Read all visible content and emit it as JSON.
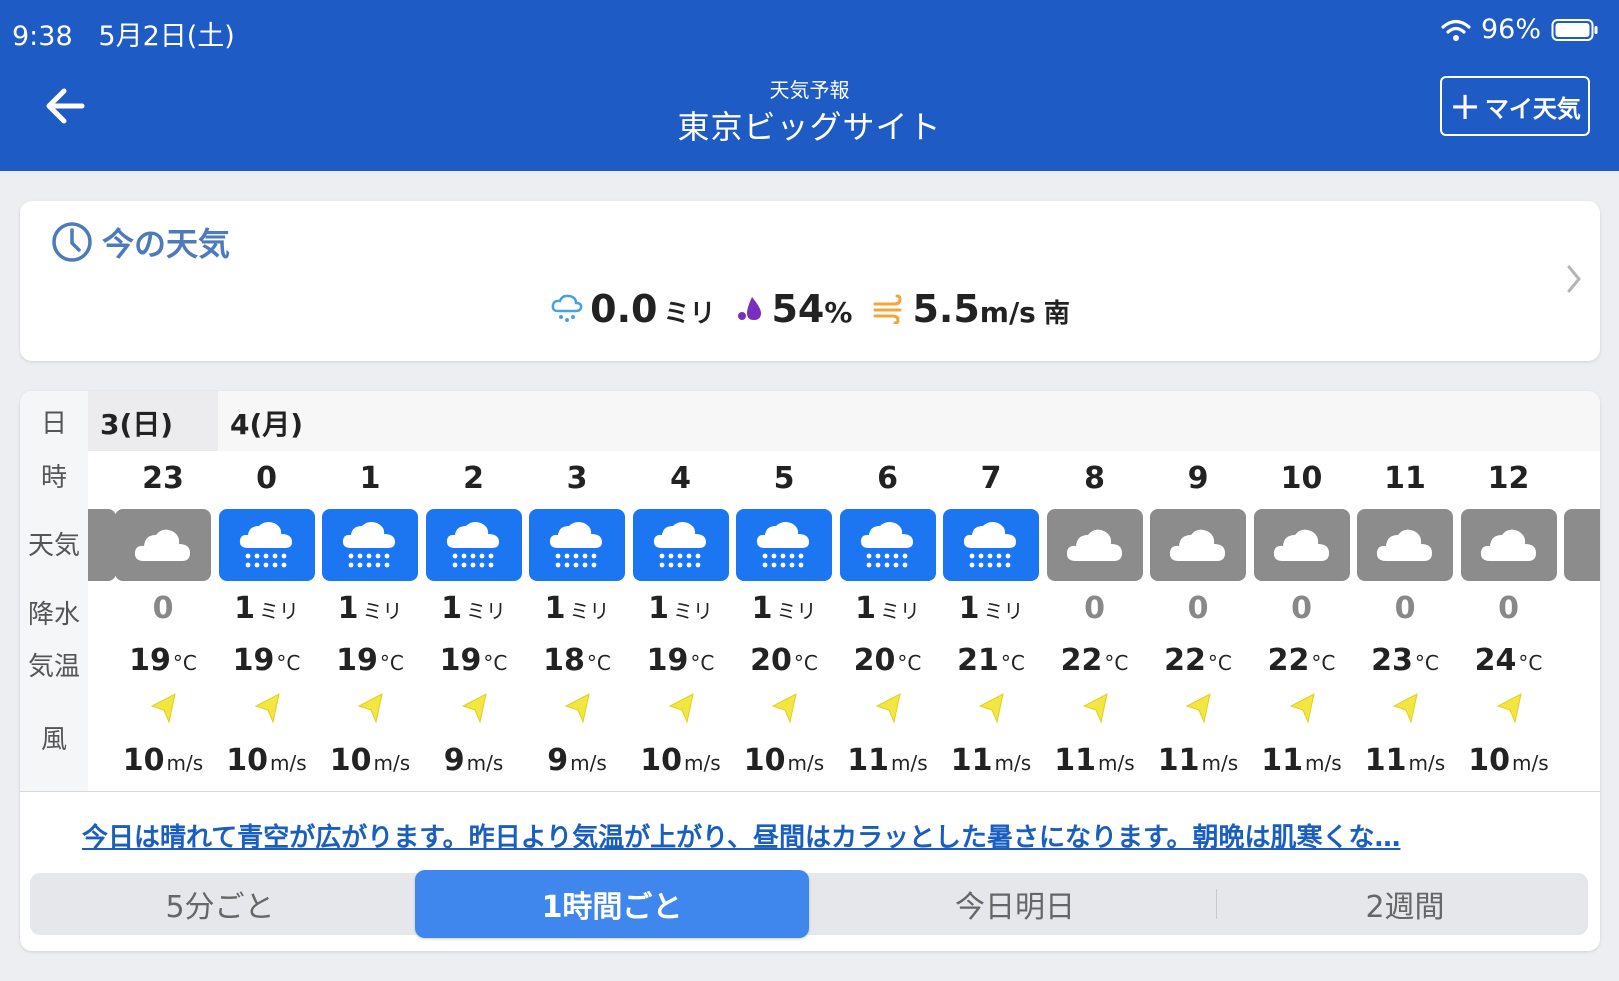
{
  "status": {
    "time": "9:38",
    "date": "5月2日(土)",
    "battery": "96%"
  },
  "header": {
    "subtitle": "天気予報",
    "title": "東京ビッグサイト",
    "my_weather_label": "マイ天気"
  },
  "current": {
    "title": "今の天気",
    "precip_value": "0.0",
    "precip_unit": "ミリ",
    "humidity_value": "54",
    "humidity_unit": "%",
    "wind_value": "5.5",
    "wind_unit": "m/s",
    "wind_dir": "南"
  },
  "row_labels": [
    "日",
    "時",
    "天気",
    "降水",
    "気温",
    "風"
  ],
  "dates": [
    "3(日)",
    "4(月)"
  ],
  "units": {
    "precip": "ミリ",
    "temp": "°C",
    "wind": "m/s"
  },
  "hours": [
    {
      "hour": "23",
      "weather": "cloudy",
      "precip": "0",
      "temp": "19",
      "wind": "10"
    },
    {
      "hour": "0",
      "weather": "rain",
      "precip": "1",
      "temp": "19",
      "wind": "10"
    },
    {
      "hour": "1",
      "weather": "rain",
      "precip": "1",
      "temp": "19",
      "wind": "10"
    },
    {
      "hour": "2",
      "weather": "rain",
      "precip": "1",
      "temp": "19",
      "wind": "9"
    },
    {
      "hour": "3",
      "weather": "rain",
      "precip": "1",
      "temp": "18",
      "wind": "9"
    },
    {
      "hour": "4",
      "weather": "rain",
      "precip": "1",
      "temp": "19",
      "wind": "10"
    },
    {
      "hour": "5",
      "weather": "rain",
      "precip": "1",
      "temp": "20",
      "wind": "10"
    },
    {
      "hour": "6",
      "weather": "rain",
      "precip": "1",
      "temp": "20",
      "wind": "11"
    },
    {
      "hour": "7",
      "weather": "rain",
      "precip": "1",
      "temp": "21",
      "wind": "11"
    },
    {
      "hour": "8",
      "weather": "cloudy",
      "precip": "0",
      "temp": "22",
      "wind": "11"
    },
    {
      "hour": "9",
      "weather": "cloudy",
      "precip": "0",
      "temp": "22",
      "wind": "11"
    },
    {
      "hour": "10",
      "weather": "cloudy",
      "precip": "0",
      "temp": "22",
      "wind": "11"
    },
    {
      "hour": "11",
      "weather": "cloudy",
      "precip": "0",
      "temp": "23",
      "wind": "11"
    },
    {
      "hour": "12",
      "weather": "cloudy",
      "precip": "0",
      "temp": "24",
      "wind": "10"
    }
  ],
  "summary": "今日は晴れて青空が広がります。昨日より気温が上がり、昼間はカラッとした暑さになります。朝晩は肌寒くな…",
  "tabs": [
    "5分ごと",
    "1時間ごと",
    "今日明日",
    "2週間"
  ],
  "active_tab": "1時間ごと",
  "colors": {
    "header_bg": "#1f5bc4",
    "rain_bg": "#1c76f2",
    "cloud_bg": "#8c8c8c",
    "link": "#1a5fbf",
    "active_tab": "#3f87ec"
  }
}
